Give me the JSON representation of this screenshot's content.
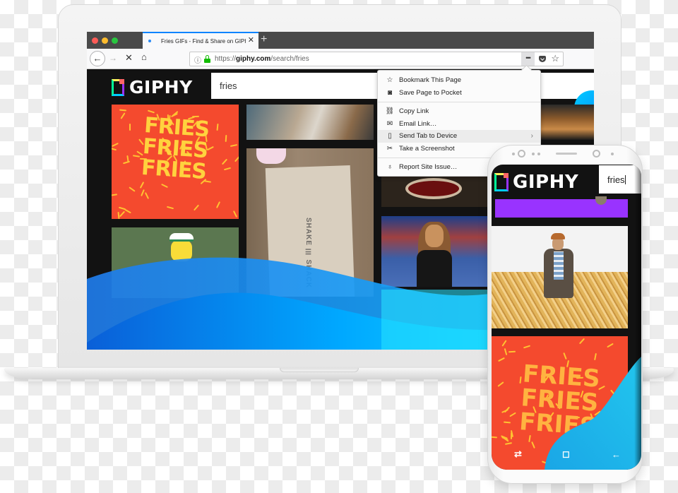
{
  "browser": {
    "tab": {
      "title": "Fries GIFs - Find & Share on GIPHY",
      "close_glyph": "✕"
    },
    "new_tab_glyph": "+",
    "nav": {
      "back_glyph": "←",
      "forward_glyph": "→",
      "stop_glyph": "✕",
      "home_glyph": "⌂"
    },
    "url": {
      "scheme": "https://",
      "host": "giphy.com",
      "path": "/search/fries",
      "info_glyph": "ⓘ",
      "more_glyph": "•••",
      "star_glyph": "☆"
    },
    "accent_color": "#0a84ff"
  },
  "page": {
    "logo": "GIPHY",
    "search_value": "fries",
    "tiles": {
      "fries_text": "FRIES\nFRIES\nFRIES",
      "shake_label": "SHAKE ☰ SHACK"
    },
    "wave_colors": [
      "#0a5fd8",
      "#00c8ff",
      "#28e6ff"
    ]
  },
  "menu": {
    "items": [
      {
        "label": "Bookmark This Page",
        "icon": "star-icon",
        "glyph": "☆"
      },
      {
        "label": "Save Page to Pocket",
        "icon": "pocket-icon",
        "glyph": "◙"
      },
      {
        "label": "Copy Link",
        "icon": "link-icon",
        "glyph": "⛓"
      },
      {
        "label": "Email Link…",
        "icon": "envelope-icon",
        "glyph": "✉"
      },
      {
        "label": "Send Tab to Device",
        "icon": "device-icon",
        "glyph": "▯",
        "submenu": "›"
      },
      {
        "label": "Take a Screenshot",
        "icon": "scissors-icon",
        "glyph": "✂"
      },
      {
        "label": "Report Site Issue…",
        "icon": "lightbulb-icon",
        "glyph": "♁"
      }
    ]
  },
  "phone": {
    "logo": "GIPHY",
    "search_value": "fries",
    "fries_text": "FRIES\nFRIES\nFRIES",
    "nav": {
      "recent_glyph": "⇄",
      "home_glyph": "◻",
      "back_glyph": "←"
    }
  }
}
